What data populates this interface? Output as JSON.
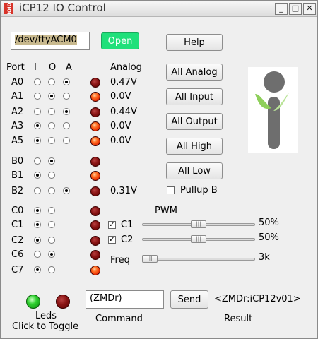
{
  "window": {
    "title": "iCP12 IO Control",
    "icon_text": "IOIO",
    "minimize": "_",
    "maximize": "□",
    "close": "✕"
  },
  "port_field": {
    "value": "/dev/ttyACM0"
  },
  "open_button": {
    "label": "Open",
    "color": "#1fe07a"
  },
  "help_button": {
    "label": "Help"
  },
  "header": {
    "port": "Port",
    "i": "I",
    "o": "O",
    "a": "A",
    "analog": "Analog"
  },
  "pins": [
    {
      "name": "A0",
      "mode": "A",
      "led": "off",
      "analog": "0.47V"
    },
    {
      "name": "A1",
      "mode": "O",
      "led": "on",
      "analog": "0.0V"
    },
    {
      "name": "A2",
      "mode": "A",
      "led": "off",
      "analog": "0.44V"
    },
    {
      "name": "A3",
      "mode": "I",
      "led": "on",
      "analog": "0.0V"
    },
    {
      "name": "A5",
      "mode": "I",
      "led": "on",
      "analog": "0.0V"
    },
    {
      "name": "B0",
      "mode": "O",
      "led": "off",
      "analog": ""
    },
    {
      "name": "B1",
      "mode": "I",
      "led": "on",
      "analog": ""
    },
    {
      "name": "B2",
      "mode": "A",
      "led": "off",
      "analog": "0.31V"
    },
    {
      "name": "C0",
      "mode": "I",
      "led": "off",
      "analog": ""
    },
    {
      "name": "C1",
      "mode": "I",
      "led": "off",
      "analog": ""
    },
    {
      "name": "C2",
      "mode": "I",
      "led": "off",
      "analog": ""
    },
    {
      "name": "C6",
      "mode": "O",
      "led": "off",
      "analog": ""
    },
    {
      "name": "C7",
      "mode": "I",
      "led": "on",
      "analog": ""
    }
  ],
  "actions": {
    "all_analog": "All Analog",
    "all_input": "All Input",
    "all_output": "All Output",
    "all_high": "All High",
    "all_low": "All Low"
  },
  "pullup": {
    "label": "Pullup B",
    "checked": false
  },
  "pwm": {
    "title": "PWM",
    "c1": {
      "label": "C1",
      "checked": true,
      "value": "50%",
      "fraction": 0.5
    },
    "c2": {
      "label": "C2",
      "checked": true,
      "value": "50%",
      "fraction": 0.5
    },
    "freq": {
      "label": "Freq",
      "value": "3k",
      "fraction": 0.0
    }
  },
  "leds": {
    "label1": "Leds",
    "label2": "Click to Toggle",
    "led1": "green",
    "led2": "red"
  },
  "command": {
    "value": "(ZMDr)",
    "label": "Command"
  },
  "send_button": {
    "label": "Send"
  },
  "result": {
    "value": "<ZMDr:iCP12v01>",
    "label": "Result"
  }
}
